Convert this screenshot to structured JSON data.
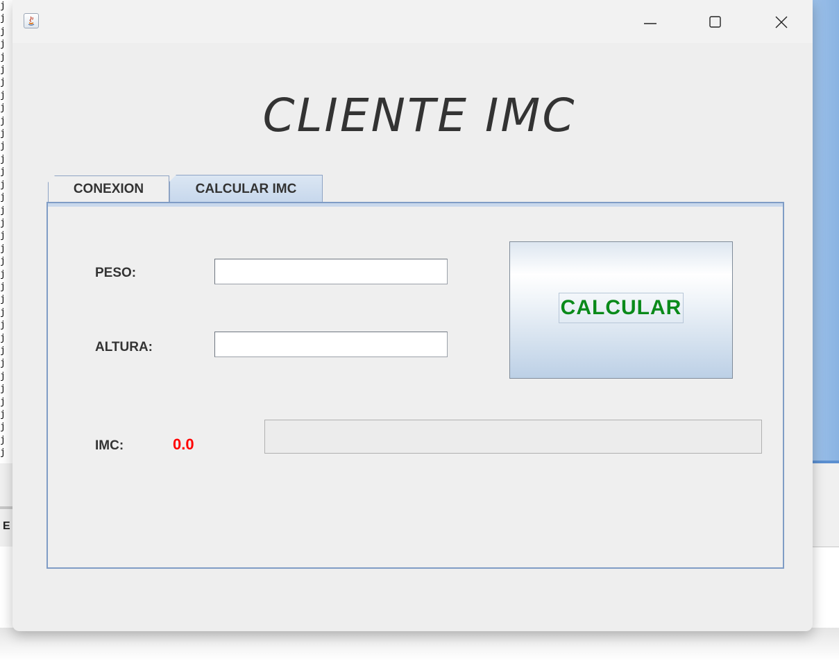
{
  "window": {
    "title": "",
    "controls": {
      "minimize": "—",
      "maximize": "☐",
      "close": "✕"
    }
  },
  "heading": "CLIENTE IMC",
  "tabs": [
    {
      "label": "CONEXION",
      "selected": false
    },
    {
      "label": "CALCULAR IMC",
      "selected": true
    }
  ],
  "form": {
    "peso_label": "PESO:",
    "peso_value": "",
    "altura_label": "ALTURA:",
    "altura_value": "",
    "imc_label": "IMC:",
    "imc_value": "0.0",
    "result_text": ""
  },
  "calculate_button": {
    "label": "CALCULAR"
  },
  "background": {
    "side_glyphs": "j\nj\nj\nj\nj\nj\nj\nj\nj\nj\nj\nj\nj\nj\nj\nj\nj\nj\nj\nj\nj\nj\nj\nj\nj\nj\nj\nj\nj\nj\nj\nj\nj\nj\nj\nj",
    "side_letter": "E"
  },
  "colors": {
    "imc_value": "#ff0000",
    "calculate_text": "#0a8a1a",
    "tab_border": "#8da3c4"
  }
}
